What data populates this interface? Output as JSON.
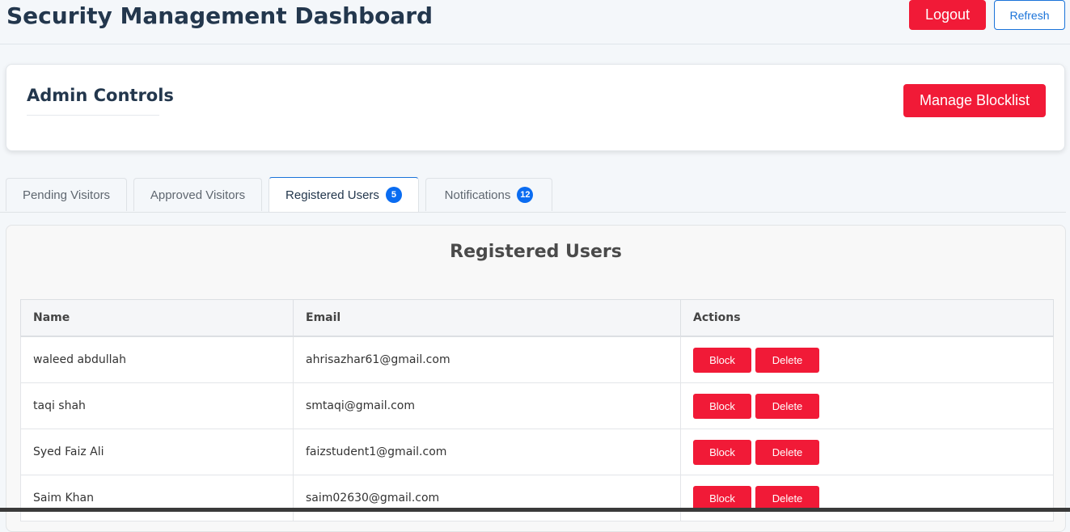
{
  "header": {
    "title": "Security Management Dashboard",
    "logout_label": "Logout",
    "refresh_label": "Refresh"
  },
  "admin_controls": {
    "title": "Admin Controls",
    "manage_blocklist_label": "Manage Blocklist"
  },
  "tabs": [
    {
      "label": "Pending Visitors",
      "badge": null,
      "active": false
    },
    {
      "label": "Approved Visitors",
      "badge": null,
      "active": false
    },
    {
      "label": "Registered Users",
      "badge": "5",
      "active": true
    },
    {
      "label": "Notifications",
      "badge": "12",
      "active": false
    }
  ],
  "panel": {
    "title": "Registered Users",
    "columns": [
      "Name",
      "Email",
      "Actions"
    ],
    "block_label": "Block",
    "delete_label": "Delete",
    "rows": [
      {
        "name": "waleed abdullah",
        "email": "ahrisazhar61@gmail.com"
      },
      {
        "name": "taqi shah",
        "email": "smtaqi@gmail.com"
      },
      {
        "name": "Syed Faiz Ali",
        "email": "faizstudent1@gmail.com"
      },
      {
        "name": "Saim Khan",
        "email": "saim02630@gmail.com"
      }
    ]
  },
  "colors": {
    "primary_red": "#f11a37",
    "accent_blue": "#1a73d9",
    "badge_blue": "#0a6cf1",
    "title_navy": "#23374d"
  }
}
